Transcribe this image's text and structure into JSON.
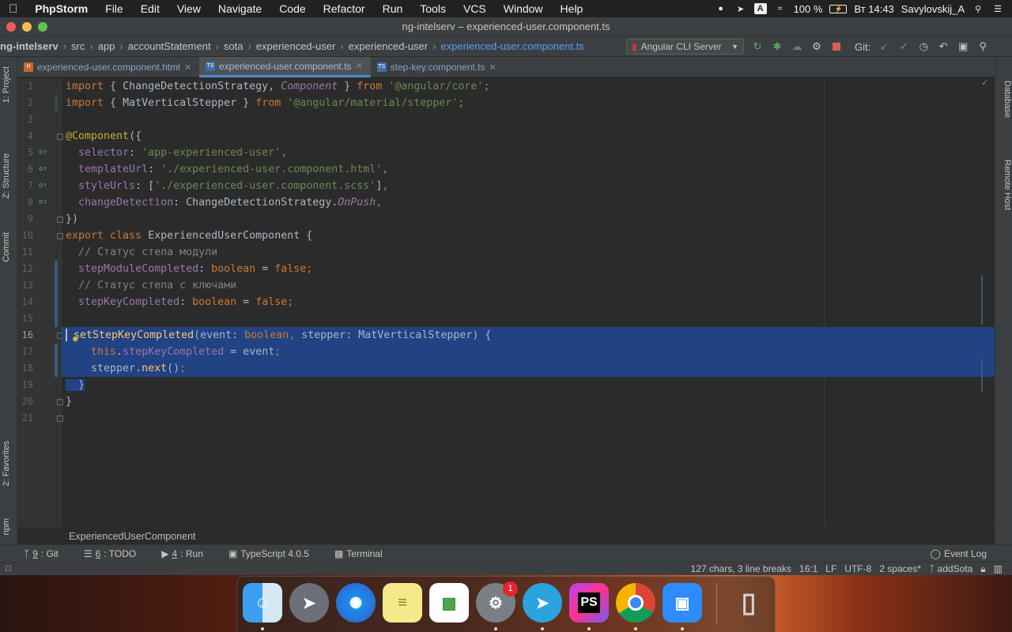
{
  "menubar": {
    "app": "PhpStorm",
    "items": [
      "File",
      "Edit",
      "View",
      "Navigate",
      "Code",
      "Refactor",
      "Run",
      "Tools",
      "VCS",
      "Window",
      "Help"
    ],
    "battery": "100 %",
    "input_lang": "A",
    "clock": "Вт 14:43",
    "user": "Savylovskij_A"
  },
  "window": {
    "title": "ng-intelserv – experienced-user.component.ts"
  },
  "navbar": {
    "crumbs": [
      "ng-intelserv",
      "src",
      "app",
      "accountStatement",
      "sota",
      "experienced-user",
      "experienced-user",
      "experienced-user.component.ts"
    ],
    "run_config": "Angular CLI Server",
    "git_label": "Git:"
  },
  "tabs": [
    {
      "label": "experienced-user.component.html",
      "kind": "html"
    },
    {
      "label": "experienced-user.component.ts",
      "kind": "ts",
      "active": true
    },
    {
      "label": "step-key.component.ts",
      "kind": "ts"
    }
  ],
  "left_tools": {
    "project": "1: Project",
    "structure": "Z: Structure",
    "commit": "Commit",
    "favorites": "2: Favorites",
    "npm": "npm"
  },
  "right_tools": {
    "database": "Database",
    "remote_host": "Remote Host"
  },
  "code": {
    "line_numbers": [
      "1",
      "2",
      "3",
      "4",
      "5",
      "6",
      "7",
      "8",
      "9",
      "10",
      "11",
      "12",
      "13",
      "14",
      "15",
      "16",
      "17",
      "18",
      "19",
      "20",
      "21"
    ],
    "current_line": "16"
  },
  "breadcrumb": {
    "label": "ExperiencedUserComponent"
  },
  "toolwindows": [
    {
      "num": "9",
      "label": ": Git"
    },
    {
      "num": "6",
      "label": ": TODO"
    },
    {
      "num": "4",
      "label": ": Run"
    },
    {
      "num": "",
      "label": "TypeScript 4.0.5"
    },
    {
      "num": "",
      "label": "Terminal"
    }
  ],
  "event_log": "Event Log",
  "status": {
    "selection": "127 chars, 3 line breaks",
    "position": "16:1",
    "line_sep": "LF",
    "encoding": "UTF-8",
    "indent": "2 spaces*",
    "branch": "addSota"
  },
  "dock": {
    "badge": "1"
  },
  "colors": {
    "selection": "#214283",
    "keyword": "#cc7832",
    "string": "#6a8759",
    "field": "#9876aa",
    "function": "#ffc66d",
    "comment": "#808080",
    "annotation": "#bbb529"
  }
}
